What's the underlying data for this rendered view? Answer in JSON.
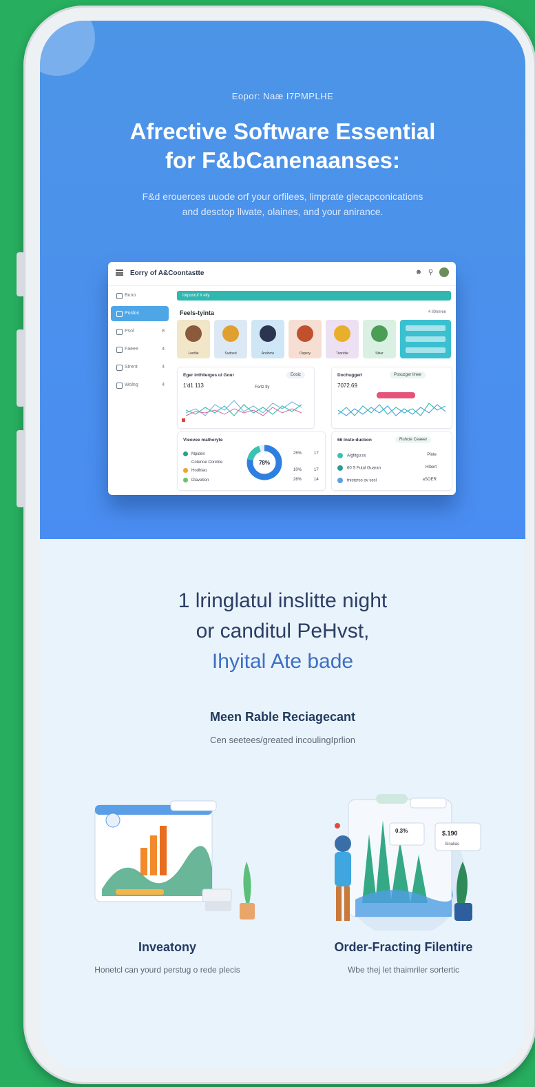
{
  "hero": {
    "eyebrow": "Eopor: Naæ I7PMPLHE",
    "title_line1": "Afrective Software Essential",
    "title_line2": "for F&bCanenaanses:",
    "subtitle_line1": "F&d erouerces uuode orf your orfilees, limprate glecapconications",
    "subtitle_line2": "and desctop llwate, olaines, and your anirance."
  },
  "mockup": {
    "app_title": "Eorry of A&Coontastte",
    "search_placeholder": "Iorpusruf lr eiiy",
    "sidebar": [
      {
        "label": "Buno",
        "count": ""
      },
      {
        "label": "Poslos",
        "count": ""
      },
      {
        "label": "Psol",
        "count": "8"
      },
      {
        "label": "Faeee",
        "count": "4"
      },
      {
        "label": "Strent",
        "count": "4"
      },
      {
        "label": "Wolng",
        "count": "4"
      }
    ],
    "section_label": "Feels-tyinta",
    "section_right": "4 ll0nmee",
    "cards": [
      "Lerdiie",
      "Sudoed",
      "Andoms",
      "Ospery",
      "Tooridie",
      "Sbier"
    ],
    "panel1": {
      "title": "Eger inthilerges ul Gour",
      "value": "1′d1 113",
      "chip": "Fertz lty",
      "tab": "Eooiz"
    },
    "panel2": {
      "title": "Dochuggerl",
      "value": "7072.69",
      "chip": "Posuzger linee"
    },
    "panel3": {
      "title": "Vleovee matheryte",
      "donut": "78%",
      "rows": [
        {
          "label": "Mpiden",
          "v1": "25%",
          "v2": "17"
        },
        {
          "label": "Cotenoe Conmte",
          "v1": "",
          "v2": ""
        },
        {
          "label": "Hodhlao",
          "v1": "10%",
          "v2": "17"
        },
        {
          "label": "Dlavebon",
          "v1": "26%",
          "v2": "14"
        }
      ]
    },
    "panel4": {
      "title": "66 Inste-ducbon",
      "chip": "Ruhcte Ceaeer",
      "rows": [
        {
          "label": "Algfitgu:ss",
          "r": "Pinte"
        },
        {
          "label": "60 S Futal Guaran",
          "r": "Hlbert"
        },
        {
          "label": "tnisterso ov sesl",
          "r": "aSOER"
        }
      ]
    }
  },
  "section2": {
    "heading_line1": "1 lringlatul inslitte night",
    "heading_line2": "or canditul PeHvst,",
    "heading_line3": "Ihyital Ate bade",
    "subheading": "Meen Rable Reciagecant",
    "subtext": "Cen seetees/greated incoulingIprlion"
  },
  "features": [
    {
      "title": "Inveatony",
      "desc": "Honetcl can yourd perstug o rede plecis"
    },
    {
      "title": "Order-Fracting Filentire",
      "desc": "Wbe thej let thaimriler sortertic"
    }
  ],
  "illus2_badges": [
    "0.3%",
    "$.190",
    "Sinalias"
  ],
  "colors": {
    "bg_green": "#27ae5f",
    "hero_blue": "#4c95e6",
    "accent": "#3d6fc4"
  }
}
